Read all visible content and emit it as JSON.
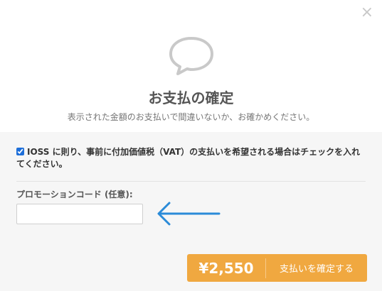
{
  "dialog": {
    "close_glyph": "×",
    "title": "お支払の確定",
    "subtitle": "表示された金額のお支払いで間違いないか、お確かめください。"
  },
  "ioss": {
    "checked": true,
    "label": "IOSS に則り、事前に付加価値税（VAT）の支払いを希望される場合はチェックを入れてください。"
  },
  "promo": {
    "label": "プロモーションコード (任意):",
    "value": "",
    "placeholder": ""
  },
  "payment": {
    "price": "¥2,550",
    "confirm_label": "支払いを確定する"
  },
  "colors": {
    "accent": "#f0a840",
    "arrow": "#2b8bd8"
  },
  "icons": {
    "close": "close-icon",
    "chat": "chat-bubble-icon",
    "arrow": "arrow-left-icon"
  }
}
